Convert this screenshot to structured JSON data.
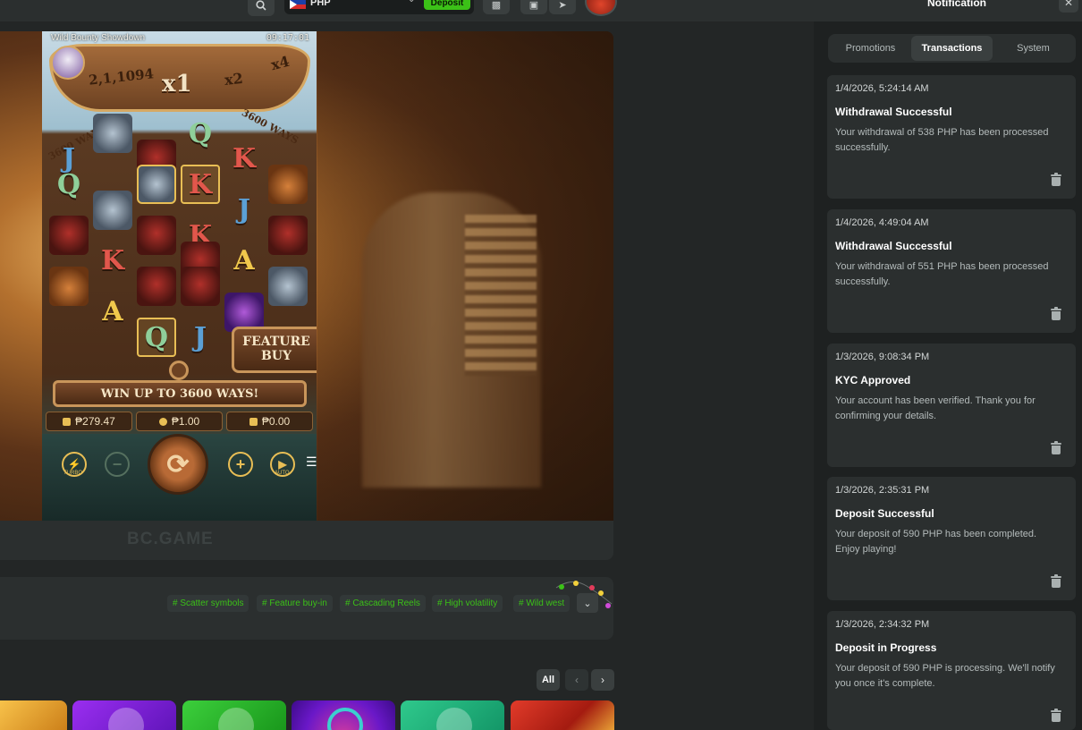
{
  "topbar": {
    "currency_code": "PHP",
    "deposit_label": "Deposit"
  },
  "game": {
    "title": "Wild Bounty Showdown",
    "clock": "09:17:01",
    "ways_count": "2,1,1094",
    "multipliers": [
      "x1",
      "x2",
      "x4"
    ],
    "side_text_left": "3600 WAYS",
    "side_text_right": "3600 WAYS",
    "feature_buy_line1": "FEATURE",
    "feature_buy_line2": "BUY",
    "win_banner": "WIN UP TO 3600 WAYS!",
    "balance": "₱279.47",
    "bet": "₱1.00",
    "win": "₱0.00",
    "turbo_label": "TURBO",
    "auto_label": "AUTO",
    "reel_symbols": [
      {
        "row": 0,
        "col": 1,
        "glyph": "",
        "kind": "gun"
      },
      {
        "row": 0,
        "col": 3,
        "glyph": "Q",
        "kind": "q"
      },
      {
        "row": 1,
        "col": 0,
        "glyph": "J",
        "kind": "j"
      },
      {
        "row": 1,
        "col": 2,
        "glyph": "",
        "kind": "bandit"
      },
      {
        "row": 1,
        "col": 4,
        "glyph": "K",
        "kind": "k"
      },
      {
        "row": 2,
        "col": 0,
        "glyph": "Q",
        "kind": "q"
      },
      {
        "row": 2,
        "col": 2,
        "glyph": "",
        "kind": "gun"
      },
      {
        "row": 2,
        "col": 3,
        "glyph": "K",
        "kind": "k"
      },
      {
        "row": 2,
        "col": 5,
        "glyph": "",
        "kind": "bottle"
      },
      {
        "row": 3,
        "col": 1,
        "glyph": "",
        "kind": "gun"
      },
      {
        "row": 3,
        "col": 4,
        "glyph": "J",
        "kind": "j"
      },
      {
        "row": 4,
        "col": 0,
        "glyph": "",
        "kind": "bandit"
      },
      {
        "row": 4,
        "col": 2,
        "glyph": "",
        "kind": "bandit"
      },
      {
        "row": 4,
        "col": 3,
        "glyph": "K",
        "kind": "k"
      },
      {
        "row": 4,
        "col": 5,
        "glyph": "",
        "kind": "bandit"
      },
      {
        "row": 5,
        "col": 1,
        "glyph": "K",
        "kind": "k"
      },
      {
        "row": 5,
        "col": 3,
        "glyph": "",
        "kind": "bandit"
      },
      {
        "row": 5,
        "col": 4,
        "glyph": "A",
        "kind": "a"
      },
      {
        "row": 6,
        "col": 0,
        "glyph": "",
        "kind": "bottle"
      },
      {
        "row": 6,
        "col": 2,
        "glyph": "",
        "kind": "bandit"
      },
      {
        "row": 6,
        "col": 3,
        "glyph": "",
        "kind": "bandit"
      },
      {
        "row": 6,
        "col": 5,
        "glyph": "",
        "kind": "gun"
      },
      {
        "row": 7,
        "col": 1,
        "glyph": "A",
        "kind": "a"
      },
      {
        "row": 7,
        "col": 4,
        "glyph": "",
        "kind": "hat"
      },
      {
        "row": 8,
        "col": 2,
        "glyph": "Q",
        "kind": "q"
      },
      {
        "row": 8,
        "col": 3,
        "glyph": "J",
        "kind": "j"
      }
    ],
    "gold_frames": [
      {
        "row": 2,
        "col": 2
      },
      {
        "row": 2,
        "col": 3
      },
      {
        "row": 8,
        "col": 2
      }
    ]
  },
  "stage_footer": {
    "watermark": "BC.GAME"
  },
  "tags": [
    "# Scatter symbols",
    "# Feature buy-in",
    "# Cascading Reels",
    "# High volatility",
    "# Wild west"
  ],
  "games_nav": {
    "all_label": "All"
  },
  "notifications": {
    "title": "Notification",
    "tabs": [
      {
        "label": "Promotions",
        "active": false
      },
      {
        "label": "Transactions",
        "active": true
      },
      {
        "label": "System",
        "active": false
      }
    ],
    "items": [
      {
        "time": "1/4/2026, 5:24:14 AM",
        "title": "Withdrawal Successful",
        "body": "Your withdrawal of 538 PHP has been processed successfully."
      },
      {
        "time": "1/4/2026, 4:49:04 AM",
        "title": "Withdrawal Successful",
        "body": "Your withdrawal of 551 PHP has been processed successfully."
      },
      {
        "time": "1/3/2026, 9:08:34 PM",
        "title": "KYC Approved",
        "body": "Your account has been verified. Thank you for confirming your details."
      },
      {
        "time": "1/3/2026, 2:35:31 PM",
        "title": "Deposit Successful",
        "body": "Your deposit of 590 PHP has been completed. Enjoy playing!"
      },
      {
        "time": "1/3/2026, 2:34:32 PM",
        "title": "Deposit in Progress",
        "body": "Your deposit of 590 PHP is processing. We'll notify you once it's complete."
      }
    ]
  },
  "colors": {
    "accent_green": "#3bc117",
    "panel_bg": "#2b2f2f",
    "page_bg": "#232626"
  }
}
